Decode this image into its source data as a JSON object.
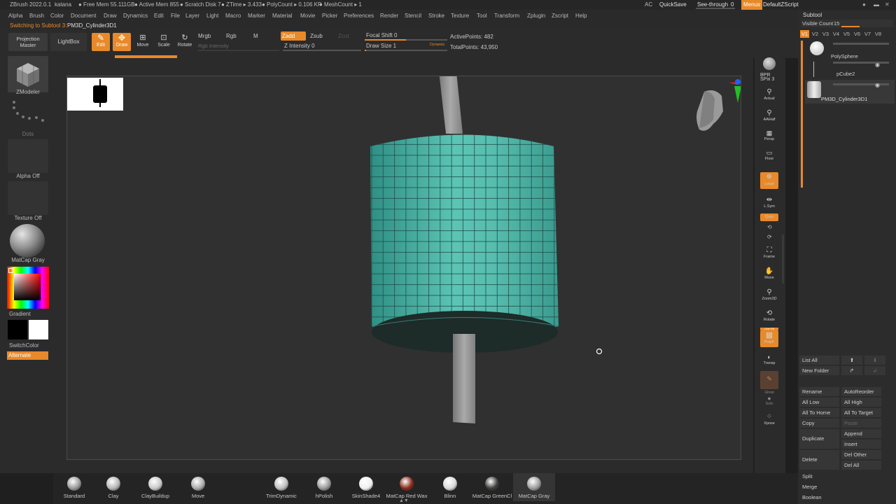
{
  "titlebar": {
    "app": "ZBrush 2022.0.1",
    "project": "katana",
    "free_mem": "● Free Mem 55.111GB",
    "active_mem": "● Active Mem 855",
    "scratch": "● Scratch Disk 7",
    "ztime": "● ZTime ▸ 3.433",
    "polycount": "● PolyCount ▸ 0.106 KP",
    "meshcount": "● MeshCount ▸ 1",
    "ac": "AC",
    "quicksave": "QuickSave",
    "see_through": "See-through",
    "see_through_value": "0",
    "menus": "Menus",
    "default_zscript": "DefaultZScript"
  },
  "menubar": [
    "Alpha",
    "Brush",
    "Color",
    "Document",
    "Draw",
    "Dynamics",
    "Edit",
    "File",
    "Layer",
    "Light",
    "Macro",
    "Marker",
    "Material",
    "Movie",
    "Picker",
    "Preferences",
    "Render",
    "Stencil",
    "Stroke",
    "Texture",
    "Tool",
    "Transform",
    "Zplugin",
    "Zscript",
    "Help"
  ],
  "status": {
    "text": "Switching to Subtool 3:",
    "subtool": "PM3D_Cylinder3D1"
  },
  "topshelf": {
    "projection_master": "Projection Master",
    "lightbox": "LightBox",
    "edit": "Edit",
    "draw": "Draw",
    "move": "Move",
    "scale": "Scale",
    "rotate": "Rotate",
    "mrgb": "Mrgb",
    "rgb": "Rgb",
    "m": "M",
    "rgb_intensity": "Rgb Intensity",
    "zadd": "Zadd",
    "zsub": "Zsub",
    "zcut": "Zcut",
    "z_intensity": "Z Intensity 0",
    "focal_shift": "Focal Shift 0",
    "draw_size": "Draw Size 1",
    "dynamic": "Dynamic",
    "active_points": "ActivePoints: 482",
    "total_points": "TotalPoints: 43,950",
    "z_intensity_level": 0.0,
    "focal_shift_level": 0.5,
    "draw_size_level": 0.01
  },
  "leftshelf": {
    "zmodeler": "ZModeler",
    "dots": "Dots",
    "alpha_off": "Alpha Off",
    "texture_off": "Texture Off",
    "matcap_gray": "MatCap Gray",
    "gradient": "Gradient",
    "switchcolor": "SwitchColor",
    "alternate": "Alternate"
  },
  "rightshelf": {
    "bpr": "BPR",
    "spix": "SPix 3",
    "actual": "Actual",
    "aahalf": "AAHalf",
    "persp": "Persp",
    "floor": "Floor",
    "local": "Local",
    "lsym": "L.Sym",
    "xyz": "Qxyz",
    "frame": "Frame",
    "move": "Move",
    "zoom3d": "Zoom3D",
    "rotate": "Rotate",
    "polyf": "PolyF",
    "transp": "Transp",
    "ghost": "Ghost",
    "solo": "Solo",
    "xpose": "Xpose",
    "linefill": "Line Fill"
  },
  "subtool": {
    "title": "Subtool",
    "visible_count": "Visible Count",
    "visible_count_value": "15",
    "versions": [
      "V1",
      "V2",
      "V3",
      "V4",
      "V5",
      "V6",
      "V7",
      "V8"
    ],
    "items": [
      "PolySphere",
      "pCube2",
      "PM3D_Cylinder3D1"
    ],
    "list_all": "List All",
    "new_folder": "New Folder",
    "rename": "Rename",
    "auto_reorder": "AutoReorder",
    "all_low": "All Low",
    "all_high": "All High",
    "all_to_home": "All To Home",
    "all_to_target": "All To Target",
    "copy": "Copy",
    "paste": "Paste",
    "duplicate": "Duplicate",
    "append": "Append",
    "insert": "Insert",
    "delete": "Delete",
    "del_other": "Del Other",
    "del_all": "Del All",
    "split": "Split",
    "merge": "Merge",
    "boolean": "Boolean"
  },
  "bottomshelf": [
    {
      "label": "Standard",
      "color": "#9a9a9a"
    },
    {
      "label": "Clay",
      "color": "#b5b5b5"
    },
    {
      "label": "ClayBuildup",
      "color": "#c8c8c8"
    },
    {
      "label": "Move",
      "color": "#aaaaaa"
    },
    {
      "label": "TrimDynamic",
      "color": "#bdbdbd"
    },
    {
      "label": "hPolish",
      "color": "#9a9a9a"
    },
    {
      "label": "SkinShade4",
      "color": "#efefef"
    },
    {
      "label": "MatCap Red Wax",
      "color": "#8a2a1a"
    },
    {
      "label": "Blinn",
      "color": "#d9d9d9"
    },
    {
      "label": "MatCap GreenCl",
      "color": "#3c3c3a"
    },
    {
      "label": "MatCap Gray",
      "color": "#9c9c9c"
    }
  ],
  "colors": {
    "accent": "#e8892a",
    "mesh": "#4fb3a5",
    "canvas": "#303030"
  }
}
